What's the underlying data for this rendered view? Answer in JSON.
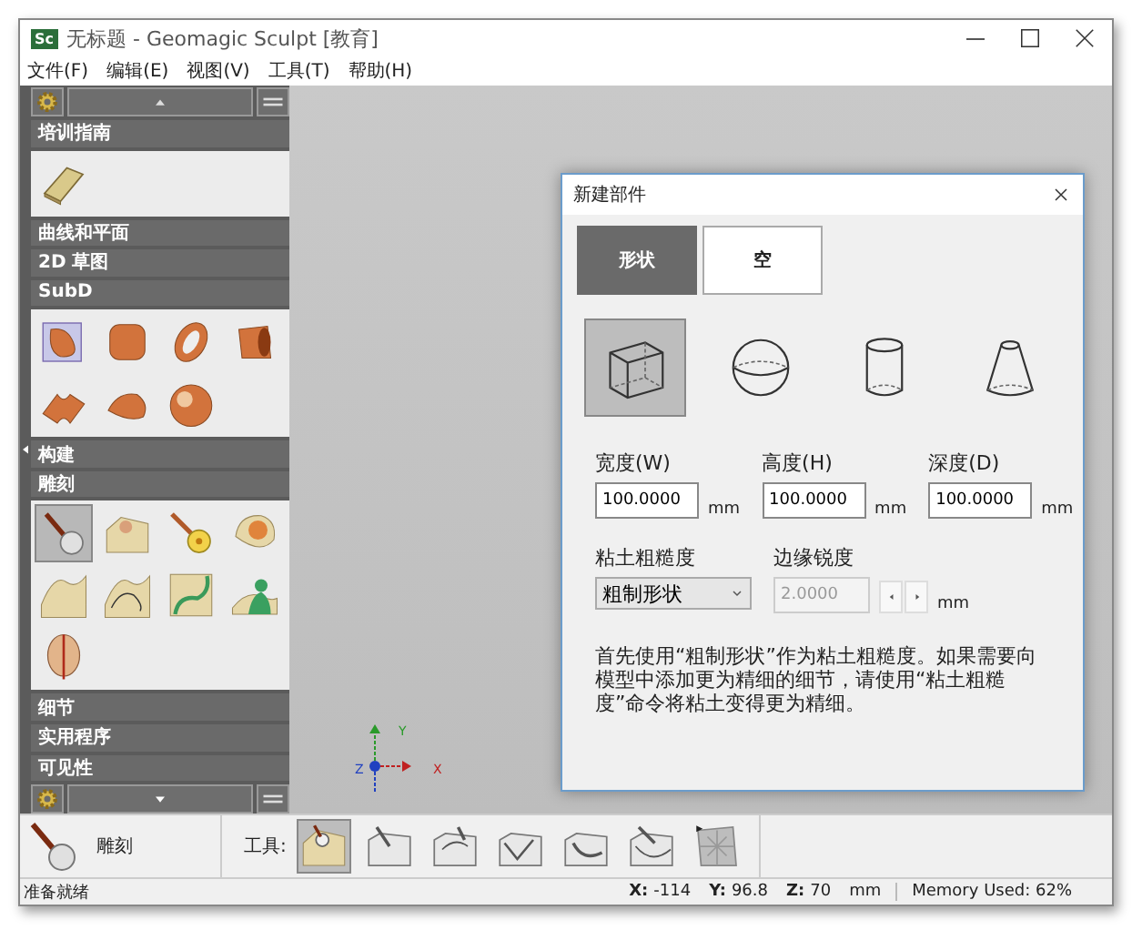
{
  "window": {
    "app_icon": "Sc",
    "title": "无标题 - Geomagic Sculpt [教育]"
  },
  "menu": [
    "文件(F)",
    "编辑(E)",
    "视图(V)",
    "工具(T)",
    "帮助(H)"
  ],
  "sidebar": {
    "sections": [
      {
        "title": "培训指南",
        "tools": [
          {
            "selected": false
          }
        ]
      },
      {
        "title": "曲线和平面"
      },
      {
        "title": "2D 草图"
      },
      {
        "title": "SubD",
        "tools": [
          {
            "selected": false
          },
          {
            "selected": false
          },
          {
            "selected": false
          },
          {
            "selected": false
          },
          {
            "selected": false
          },
          {
            "selected": false
          },
          {
            "selected": false
          }
        ]
      },
      {
        "title": "构建"
      },
      {
        "title": "雕刻",
        "tools": [
          {
            "selected": true
          },
          {
            "selected": false
          },
          {
            "selected": false
          },
          {
            "selected": false
          },
          {
            "selected": false
          },
          {
            "selected": false
          },
          {
            "selected": false
          },
          {
            "selected": false
          },
          {
            "selected": false
          }
        ]
      },
      {
        "title": "细节"
      },
      {
        "title": "实用程序"
      },
      {
        "title": "可见性"
      }
    ]
  },
  "canvas": {
    "axes": [
      {
        "label": "Y",
        "color": "#2a9a2a"
      },
      {
        "label": "Z",
        "color": "#2040c0"
      },
      {
        "label": "X",
        "color": "#c02020"
      }
    ]
  },
  "dialog": {
    "title": "新建部件",
    "tabs": [
      {
        "label": "形状",
        "selected": true
      },
      {
        "label": "空",
        "selected": false
      }
    ],
    "shapes": [
      {
        "selected": true
      },
      {
        "selected": false
      },
      {
        "selected": false
      },
      {
        "selected": false
      }
    ],
    "fields": [
      {
        "label": "宽度(W)",
        "value": "100.0000",
        "unit": "mm"
      },
      {
        "label": "高度(H)",
        "value": "100.0000",
        "unit": "mm"
      },
      {
        "label": "深度(D)",
        "value": "100.0000",
        "unit": "mm"
      }
    ],
    "roughness": {
      "label": "粘土粗糙度",
      "value": "粗制形状"
    },
    "sharpness": {
      "label": "边缘锐度",
      "value": "2.0000",
      "unit": "mm",
      "disabled": true
    },
    "description": "首先使用“粗制形状”作为粘土粗糙度。如果需要向模型中添加更为精细的细节，请使用“粘土粗糙度”命令将粘土变得更为精细。"
  },
  "toolbar": {
    "current_tool": "雕刻",
    "tools_label": "工具:",
    "tools": [
      {
        "selected": true
      },
      {
        "selected": false
      },
      {
        "selected": false
      },
      {
        "selected": false
      },
      {
        "selected": false
      },
      {
        "selected": false
      },
      {
        "selected": false
      }
    ]
  },
  "status_bar": {
    "message": "准备就绪",
    "coords": [
      {
        "label": "X:",
        "value": "-114"
      },
      {
        "label": "Y:",
        "value": "96.8"
      },
      {
        "label": "Z:",
        "value": "70"
      }
    ],
    "unit": "mm",
    "memory": "Memory Used: 62%"
  }
}
